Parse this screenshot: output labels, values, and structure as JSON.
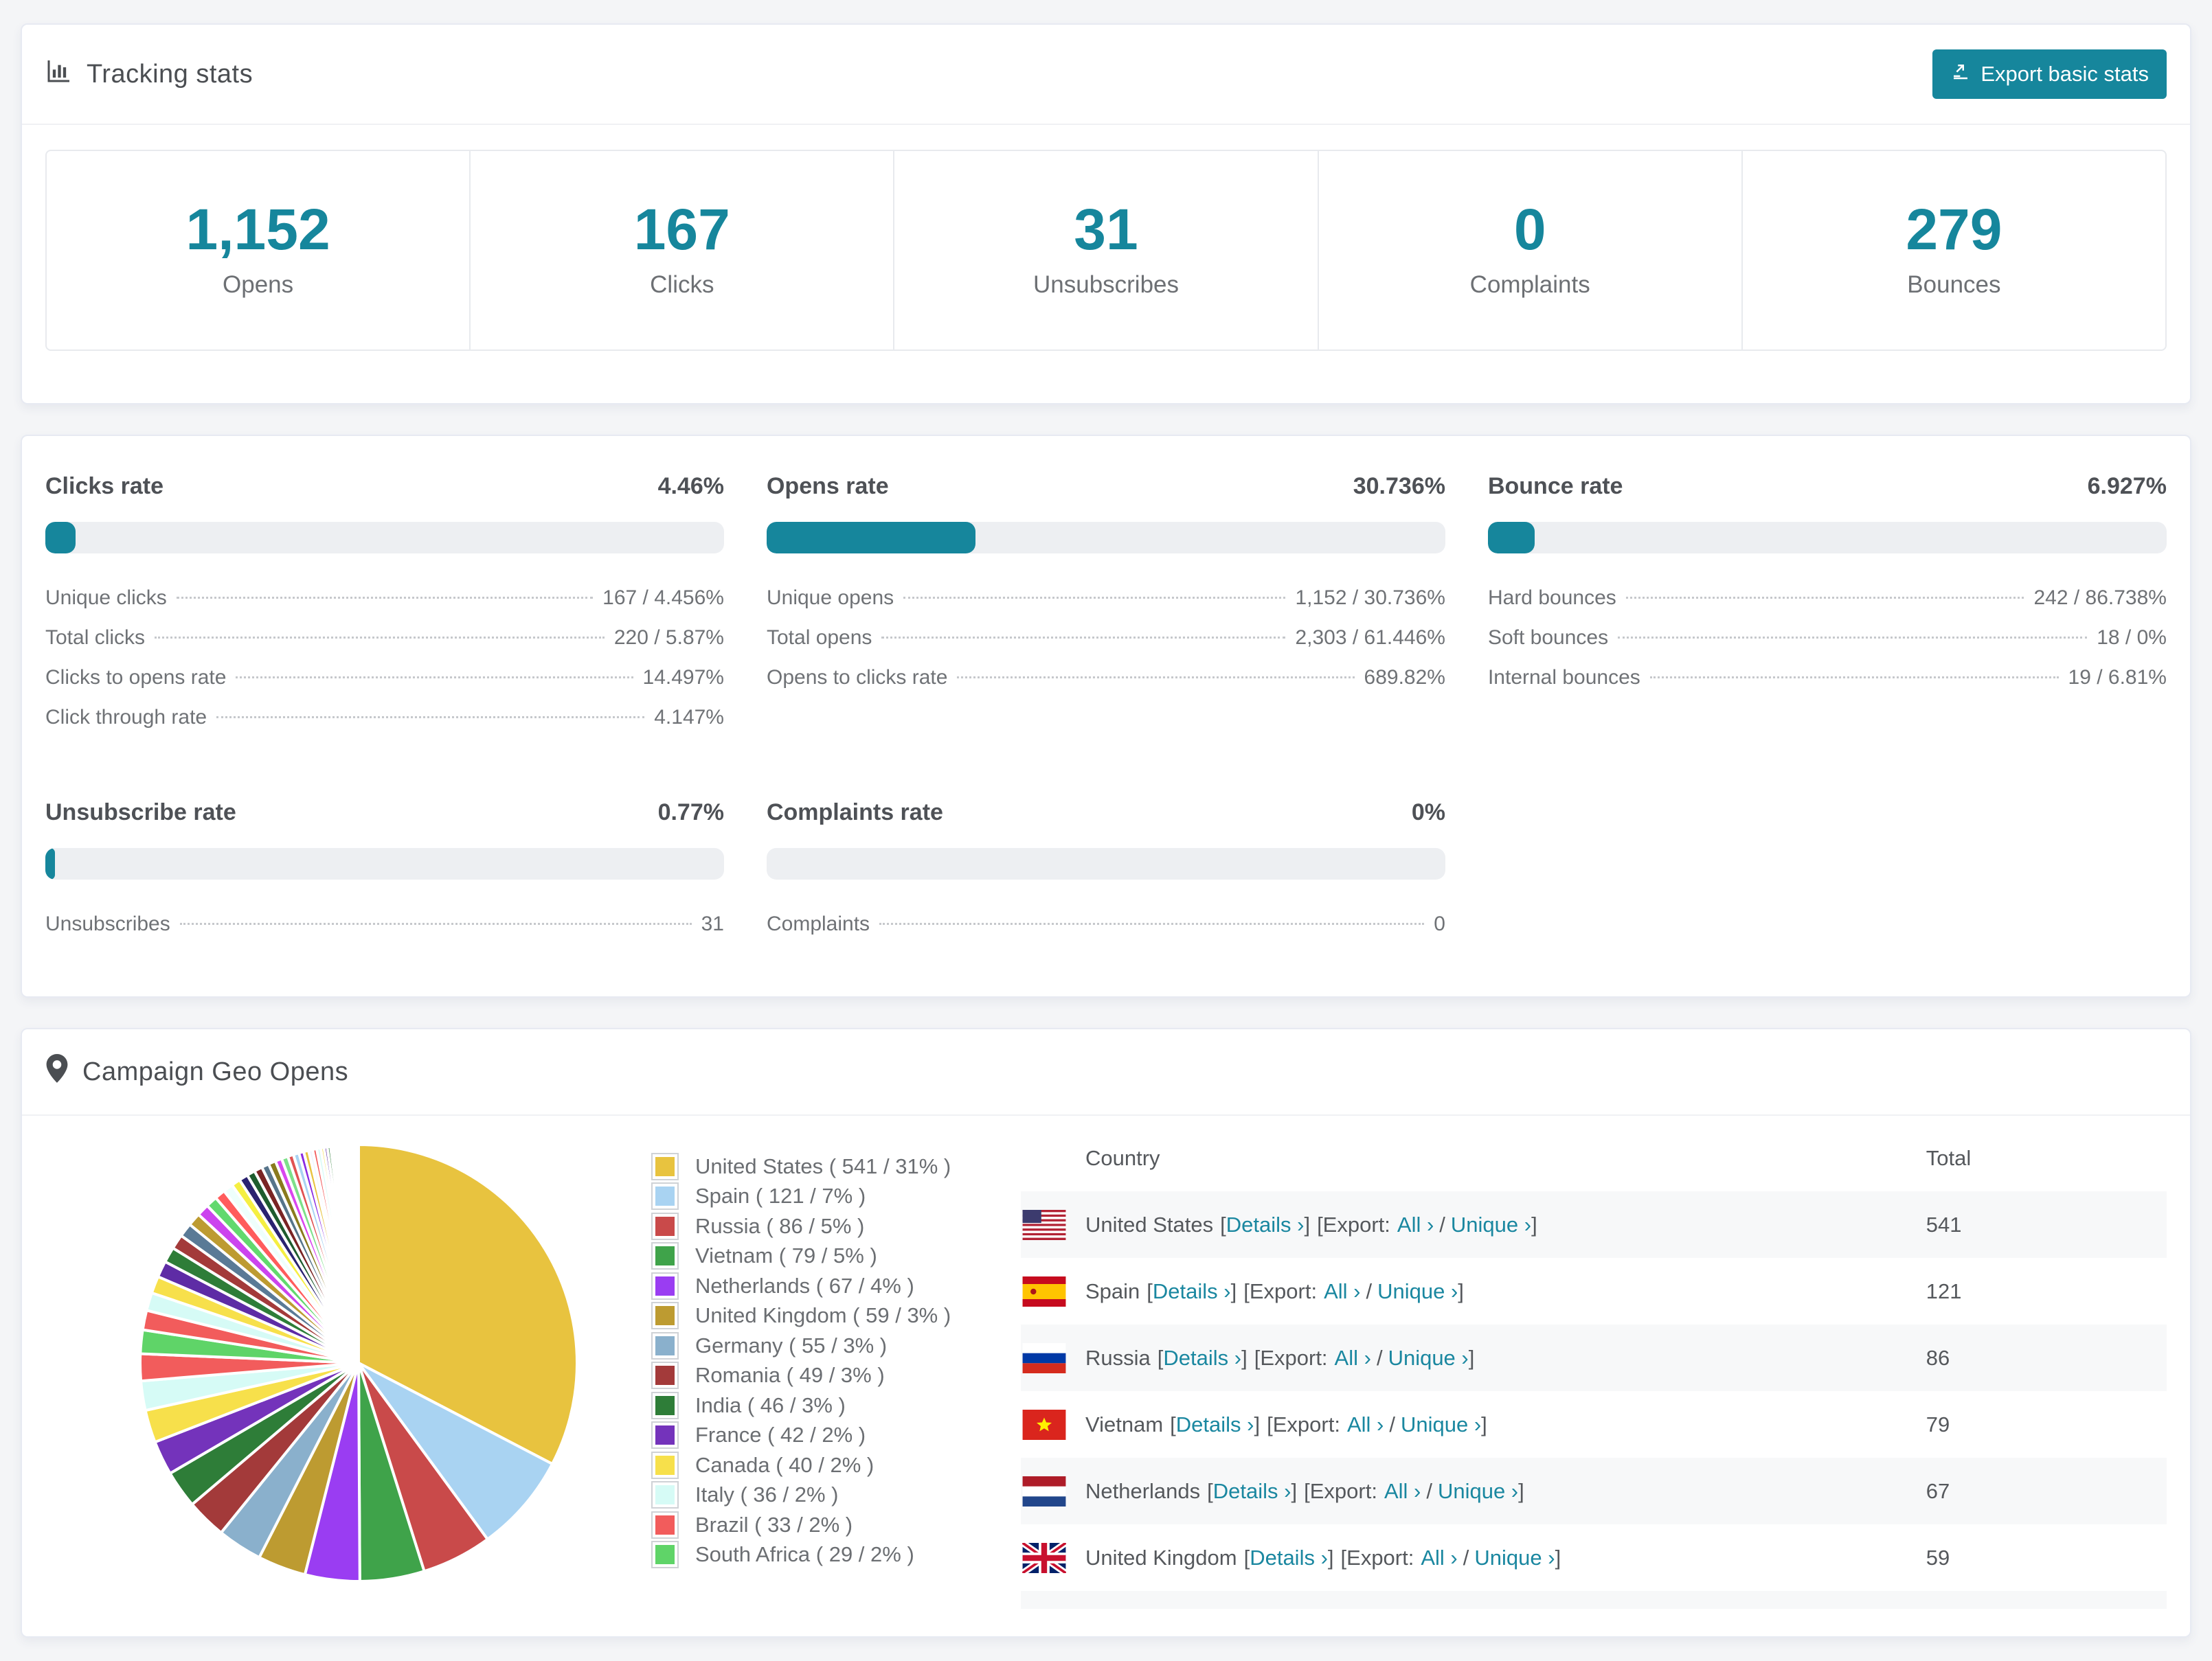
{
  "accent_color": "#16869c",
  "tracking": {
    "title": "Tracking stats",
    "icon": "bar-chart-icon",
    "export_button": {
      "label": "Export basic stats",
      "icon": "export-icon"
    },
    "stats": [
      {
        "value": "1,152",
        "label": "Opens"
      },
      {
        "value": "167",
        "label": "Clicks"
      },
      {
        "value": "31",
        "label": "Unsubscribes"
      },
      {
        "value": "0",
        "label": "Complaints"
      },
      {
        "value": "279",
        "label": "Bounces"
      }
    ]
  },
  "rates": [
    {
      "title": "Clicks rate",
      "value": "4.46%",
      "percent": 4.46,
      "rows": [
        {
          "label": "Unique clicks",
          "value": "167 / 4.456%"
        },
        {
          "label": "Total clicks",
          "value": "220 / 5.87%"
        },
        {
          "label": "Clicks to opens rate",
          "value": "14.497%"
        },
        {
          "label": "Click through rate",
          "value": "4.147%"
        }
      ]
    },
    {
      "title": "Opens rate",
      "value": "30.736%",
      "percent": 30.736,
      "rows": [
        {
          "label": "Unique opens",
          "value": "1,152 / 30.736%"
        },
        {
          "label": "Total opens",
          "value": "2,303 / 61.446%"
        },
        {
          "label": "Opens to clicks rate",
          "value": "689.82%"
        }
      ]
    },
    {
      "title": "Bounce rate",
      "value": "6.927%",
      "percent": 6.927,
      "rows": [
        {
          "label": "Hard bounces",
          "value": "242 / 86.738%"
        },
        {
          "label": "Soft bounces",
          "value": "18 / 0%"
        },
        {
          "label": "Internal bounces",
          "value": "19 / 6.81%"
        }
      ]
    },
    {
      "title": "Unsubscribe rate",
      "value": "0.77%",
      "percent": 0.77,
      "rows": [
        {
          "label": "Unsubscribes",
          "value": "31"
        }
      ]
    },
    {
      "title": "Complaints rate",
      "value": "0%",
      "percent": 0,
      "rows": [
        {
          "label": "Complaints",
          "value": "0"
        }
      ]
    }
  ],
  "geo": {
    "title": "Campaign Geo Opens",
    "icon": "map-pin-icon",
    "chart_data": {
      "type": "pie",
      "legend_position": "right",
      "slices": [
        {
          "label": "United States",
          "value": 541,
          "pct": "31%",
          "color": "#e8c33f",
          "flag": "us"
        },
        {
          "label": "Spain",
          "value": 121,
          "pct": "7%",
          "color": "#a9d3f2",
          "flag": "es"
        },
        {
          "label": "Russia",
          "value": 86,
          "pct": "5%",
          "color": "#c94a4a",
          "flag": "ru"
        },
        {
          "label": "Vietnam",
          "value": 79,
          "pct": "5%",
          "color": "#3fa34a",
          "flag": "vn"
        },
        {
          "label": "Netherlands",
          "value": 67,
          "pct": "4%",
          "color": "#9a3df2",
          "flag": "nl"
        },
        {
          "label": "United Kingdom",
          "value": 59,
          "pct": "3%",
          "color": "#bd9b31",
          "flag": "gb"
        },
        {
          "label": "Germany",
          "value": 55,
          "pct": "3%",
          "color": "#8ab0cc",
          "flag": "de"
        },
        {
          "label": "Romania",
          "value": 49,
          "pct": "3%",
          "color": "#a33a3a"
        },
        {
          "label": "India",
          "value": 46,
          "pct": "3%",
          "color": "#2e7d38"
        },
        {
          "label": "France",
          "value": 42,
          "pct": "2%",
          "color": "#7433bb"
        },
        {
          "label": "Canada",
          "value": 40,
          "pct": "2%",
          "color": "#f7e04b"
        },
        {
          "label": "Italy",
          "value": 36,
          "pct": "2%",
          "color": "#d6fbf6"
        },
        {
          "label": "Brazil",
          "value": 33,
          "pct": "2%",
          "color": "#f25c5c"
        },
        {
          "label": "South Africa",
          "value": 29,
          "pct": "2%",
          "color": "#5fd468"
        }
      ],
      "others_tail_values": [
        24,
        22,
        21,
        20,
        19,
        18,
        17,
        16,
        15,
        14,
        13,
        12,
        11,
        11,
        10,
        10,
        9,
        9,
        8,
        8,
        7,
        7,
        6,
        6,
        5,
        5,
        5,
        4,
        4,
        4,
        3,
        3,
        3,
        3,
        2,
        2,
        2,
        2,
        2,
        2,
        1,
        1,
        1,
        1,
        1,
        1,
        1,
        1,
        1,
        1
      ],
      "tail_palette": [
        "#f25c5c",
        "#d6fbf6",
        "#f7e04b",
        "#5e2ca5",
        "#2e7d38",
        "#a33a3a",
        "#5a7a96",
        "#bd9b31",
        "#cc44ee",
        "#62d96e",
        "#ff5c5c",
        "#eefffc",
        "#f5ef42",
        "#2a2270",
        "#1e5c2e",
        "#7a2424",
        "#56748a",
        "#8a7a1e",
        "#d946ef",
        "#7de08a",
        "#e05252",
        "#a9d3f2",
        "#8a2be2",
        "#e8c33f",
        "#f0f6ff"
      ]
    },
    "legend_format": {
      "open": "( ",
      "sep": " / ",
      "close": " )"
    },
    "table": {
      "columns": [
        "Country",
        "Total"
      ],
      "links": {
        "details": "Details",
        "export": "Export:",
        "all": "All",
        "unique": "Unique",
        "chevron": "›"
      },
      "rows": [
        {
          "country": "United States",
          "flag": "us",
          "total": "541"
        },
        {
          "country": "Spain",
          "flag": "es",
          "total": "121"
        },
        {
          "country": "Russia",
          "flag": "ru",
          "total": "86"
        },
        {
          "country": "Vietnam",
          "flag": "vn",
          "total": "79"
        },
        {
          "country": "Netherlands",
          "flag": "nl",
          "total": "67"
        },
        {
          "country": "United Kingdom",
          "flag": "gb",
          "total": "59"
        },
        {
          "country": "",
          "flag": "de",
          "total": "",
          "partial": true
        }
      ]
    }
  }
}
